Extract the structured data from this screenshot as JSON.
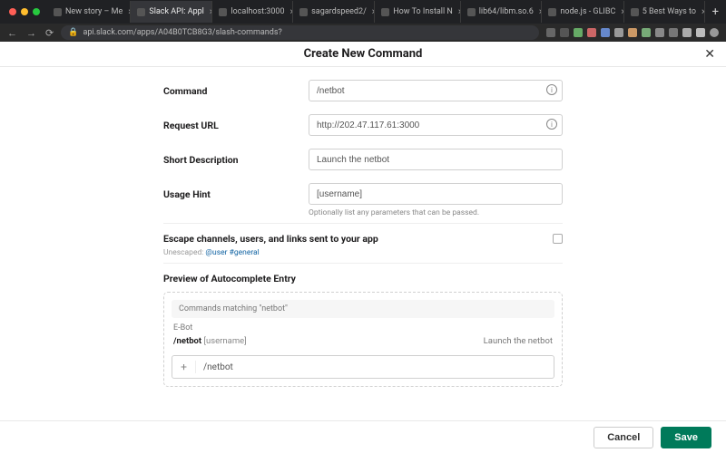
{
  "browser": {
    "tabs": [
      {
        "label": "New story – Me"
      },
      {
        "label": "Slack API: Appl"
      },
      {
        "label": "localhost:3000"
      },
      {
        "label": "sagardspeed2/"
      },
      {
        "label": "How To Install N"
      },
      {
        "label": "lib64/libm.so.6"
      },
      {
        "label": "node.js - GLIBC"
      },
      {
        "label": "5 Best Ways to"
      }
    ],
    "url": "api.slack.com/apps/A04B0TCB8G3/slash-commands?"
  },
  "header": {
    "title": "Create New Command"
  },
  "form": {
    "command": {
      "label": "Command",
      "value": "/netbot"
    },
    "request_url": {
      "label": "Request URL",
      "value": "http://202.47.117.61:3000"
    },
    "short_desc": {
      "label": "Short Description",
      "value": "Launch the netbot"
    },
    "usage_hint": {
      "label": "Usage Hint",
      "value": "[username]",
      "note": "Optionally list any parameters that can be passed."
    },
    "escape": {
      "label": "Escape channels, users, and links sent to your app",
      "unescaped_label": "Unescaped:",
      "unescaped_example": "@user #general"
    }
  },
  "preview": {
    "title": "Preview of Autocomplete Entry",
    "matching": "Commands matching \"netbot\"",
    "app": "E-Bot",
    "cmd": "/netbot",
    "usage": "[username]",
    "desc": "Launch the netbot",
    "input": "/netbot"
  },
  "footer": {
    "cancel": "Cancel",
    "save": "Save"
  }
}
